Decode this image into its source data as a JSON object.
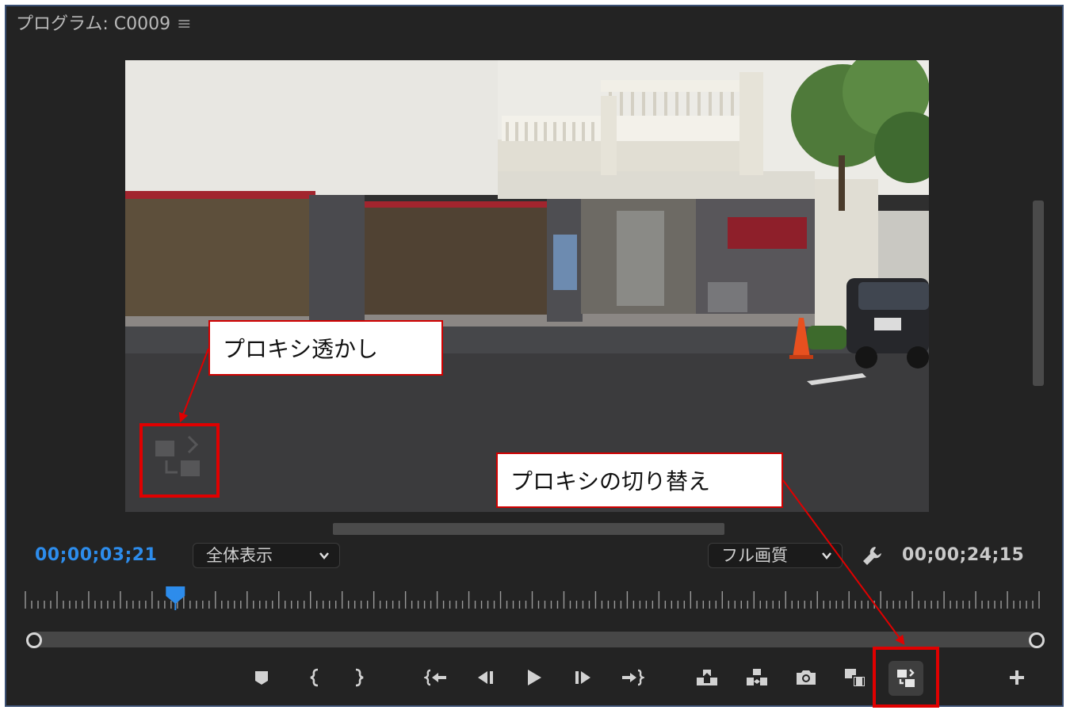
{
  "panel": {
    "title": "プログラム: C0009",
    "menu_glyph": "≡"
  },
  "timecode": {
    "current": "00;00;03;21",
    "duration": "00;00;24;15"
  },
  "controls": {
    "zoom_select": "全体表示",
    "quality_select": "フル画質"
  },
  "transport": {
    "buttons": [
      {
        "name": "add-marker-button",
        "icon": "marker-icon"
      },
      {
        "name": "mark-in-button",
        "icon": "mark-in-icon"
      },
      {
        "name": "mark-out-button",
        "icon": "mark-out-icon"
      },
      {
        "name": "go-to-in-button",
        "icon": "go-to-in-icon"
      },
      {
        "name": "step-back-button",
        "icon": "step-back-icon"
      },
      {
        "name": "play-button",
        "icon": "play-icon"
      },
      {
        "name": "step-forward-button",
        "icon": "step-forward-icon"
      },
      {
        "name": "go-to-out-button",
        "icon": "go-to-out-icon"
      },
      {
        "name": "lift-button",
        "icon": "lift-icon"
      },
      {
        "name": "extract-button",
        "icon": "extract-icon"
      },
      {
        "name": "export-frame-button",
        "icon": "camera-icon"
      },
      {
        "name": "comparison-view-button",
        "icon": "comparison-icon"
      },
      {
        "name": "toggle-proxies-button",
        "icon": "proxy-toggle-icon"
      },
      {
        "name": "button-editor-button",
        "icon": "plus-icon"
      }
    ]
  },
  "playhead_fraction": 0.148,
  "annotations": {
    "watermark_label": "プロキシ透かし",
    "toggle_label": "プロキシの切り替え"
  },
  "colors": {
    "timecode_current": "#2d8ceb",
    "annotation_red": "#e00000"
  }
}
